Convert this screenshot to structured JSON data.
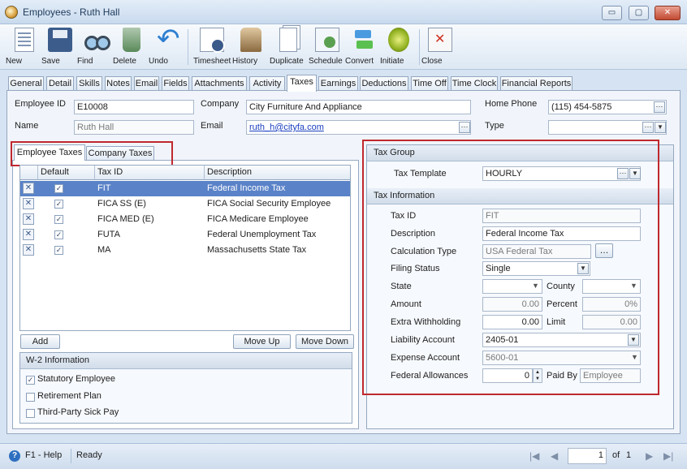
{
  "window": {
    "title": "Employees - Ruth Hall",
    "min": "▭",
    "max": "▢",
    "close": "✕"
  },
  "toolbar": [
    {
      "label": "New",
      "icon": "new-icon"
    },
    {
      "label": "Save",
      "icon": "save-icon"
    },
    {
      "label": "Find",
      "icon": "find-icon"
    },
    {
      "label": "Delete",
      "icon": "delete-icon"
    },
    {
      "label": "Undo",
      "icon": "undo-icon"
    },
    {
      "label": "Timesheet",
      "icon": "timesheet-icon"
    },
    {
      "label": "History",
      "icon": "history-icon"
    },
    {
      "label": "Duplicate",
      "icon": "duplicate-icon"
    },
    {
      "label": "Schedule",
      "icon": "schedule-icon"
    },
    {
      "label": "Convert",
      "icon": "convert-icon"
    },
    {
      "label": "Initiate",
      "icon": "initiate-icon"
    },
    {
      "label": "Close",
      "icon": "close-icon"
    }
  ],
  "tabs": [
    "General",
    "Detail",
    "Skills",
    "Notes",
    "Email",
    "Fields",
    "Attachments",
    "Activity",
    "Taxes",
    "Earnings",
    "Deductions",
    "Time Off",
    "Time Clock",
    "Financial Reports"
  ],
  "active_tab": "Taxes",
  "header": {
    "employee_id_label": "Employee ID",
    "employee_id": "E10008",
    "company_label": "Company",
    "company": "City Furniture And Appliance",
    "home_phone_label": "Home Phone",
    "home_phone": "(115) 454-5875",
    "name_label": "Name",
    "name": "Ruth Hall",
    "email_label": "Email",
    "email": "ruth_h@cityfa.com",
    "type_label": "Type",
    "type": ""
  },
  "subtabs": {
    "employee_taxes": "Employee Taxes",
    "company_taxes": "Company Taxes"
  },
  "grid": {
    "headers": {
      "default": "Default",
      "tax_id": "Tax ID",
      "description": "Description"
    },
    "rows": [
      {
        "tax_id": "FIT",
        "description": "Federal Income Tax",
        "default": true
      },
      {
        "tax_id": "FICA SS (E)",
        "description": "FICA Social Security Employee",
        "default": true
      },
      {
        "tax_id": "FICA MED (E)",
        "description": "FICA Medicare Employee",
        "default": true
      },
      {
        "tax_id": "FUTA",
        "description": "Federal Unemployment Tax",
        "default": true
      },
      {
        "tax_id": "MA",
        "description": "Massachusetts State Tax",
        "default": true
      }
    ],
    "remove_glyph": "✕",
    "check_glyph": "✓"
  },
  "buttons": {
    "add": "Add",
    "move_up": "Move Up",
    "move_down": "Move Down"
  },
  "w2": {
    "title": "W-2 Information",
    "items": [
      {
        "label": "Statutory Employee",
        "checked": true
      },
      {
        "label": "Retirement Plan",
        "checked": false
      },
      {
        "label": "Third-Party Sick Pay",
        "checked": false
      }
    ]
  },
  "tax_group": {
    "title": "Tax Group",
    "template_label": "Tax Template",
    "template": "HOURLY"
  },
  "tax_info": {
    "title": "Tax Information",
    "tax_id_label": "Tax ID",
    "tax_id": "FIT",
    "description_label": "Description",
    "description": "Federal Income Tax",
    "calc_type_label": "Calculation Type",
    "calc_type": "USA Federal Tax",
    "filing_status_label": "Filing Status",
    "filing_status": "Single",
    "state_label": "State",
    "state": "",
    "county_label": "County",
    "county": "",
    "amount_label": "Amount",
    "amount": "0.00",
    "percent_label": "Percent",
    "percent": "0%",
    "extra_label": "Extra Withholding",
    "extra": "0.00",
    "limit_label": "Limit",
    "limit": "0.00",
    "liability_label": "Liability Account",
    "liability": "2405-01",
    "expense_label": "Expense Account",
    "expense": "5600-01",
    "allowances_label": "Federal Allowances",
    "allowances": "0",
    "paid_by_label": "Paid By",
    "paid_by": "Employee"
  },
  "status": {
    "help": "F1 - Help",
    "state": "Ready",
    "page": "1",
    "of": "of",
    "total": "1"
  }
}
